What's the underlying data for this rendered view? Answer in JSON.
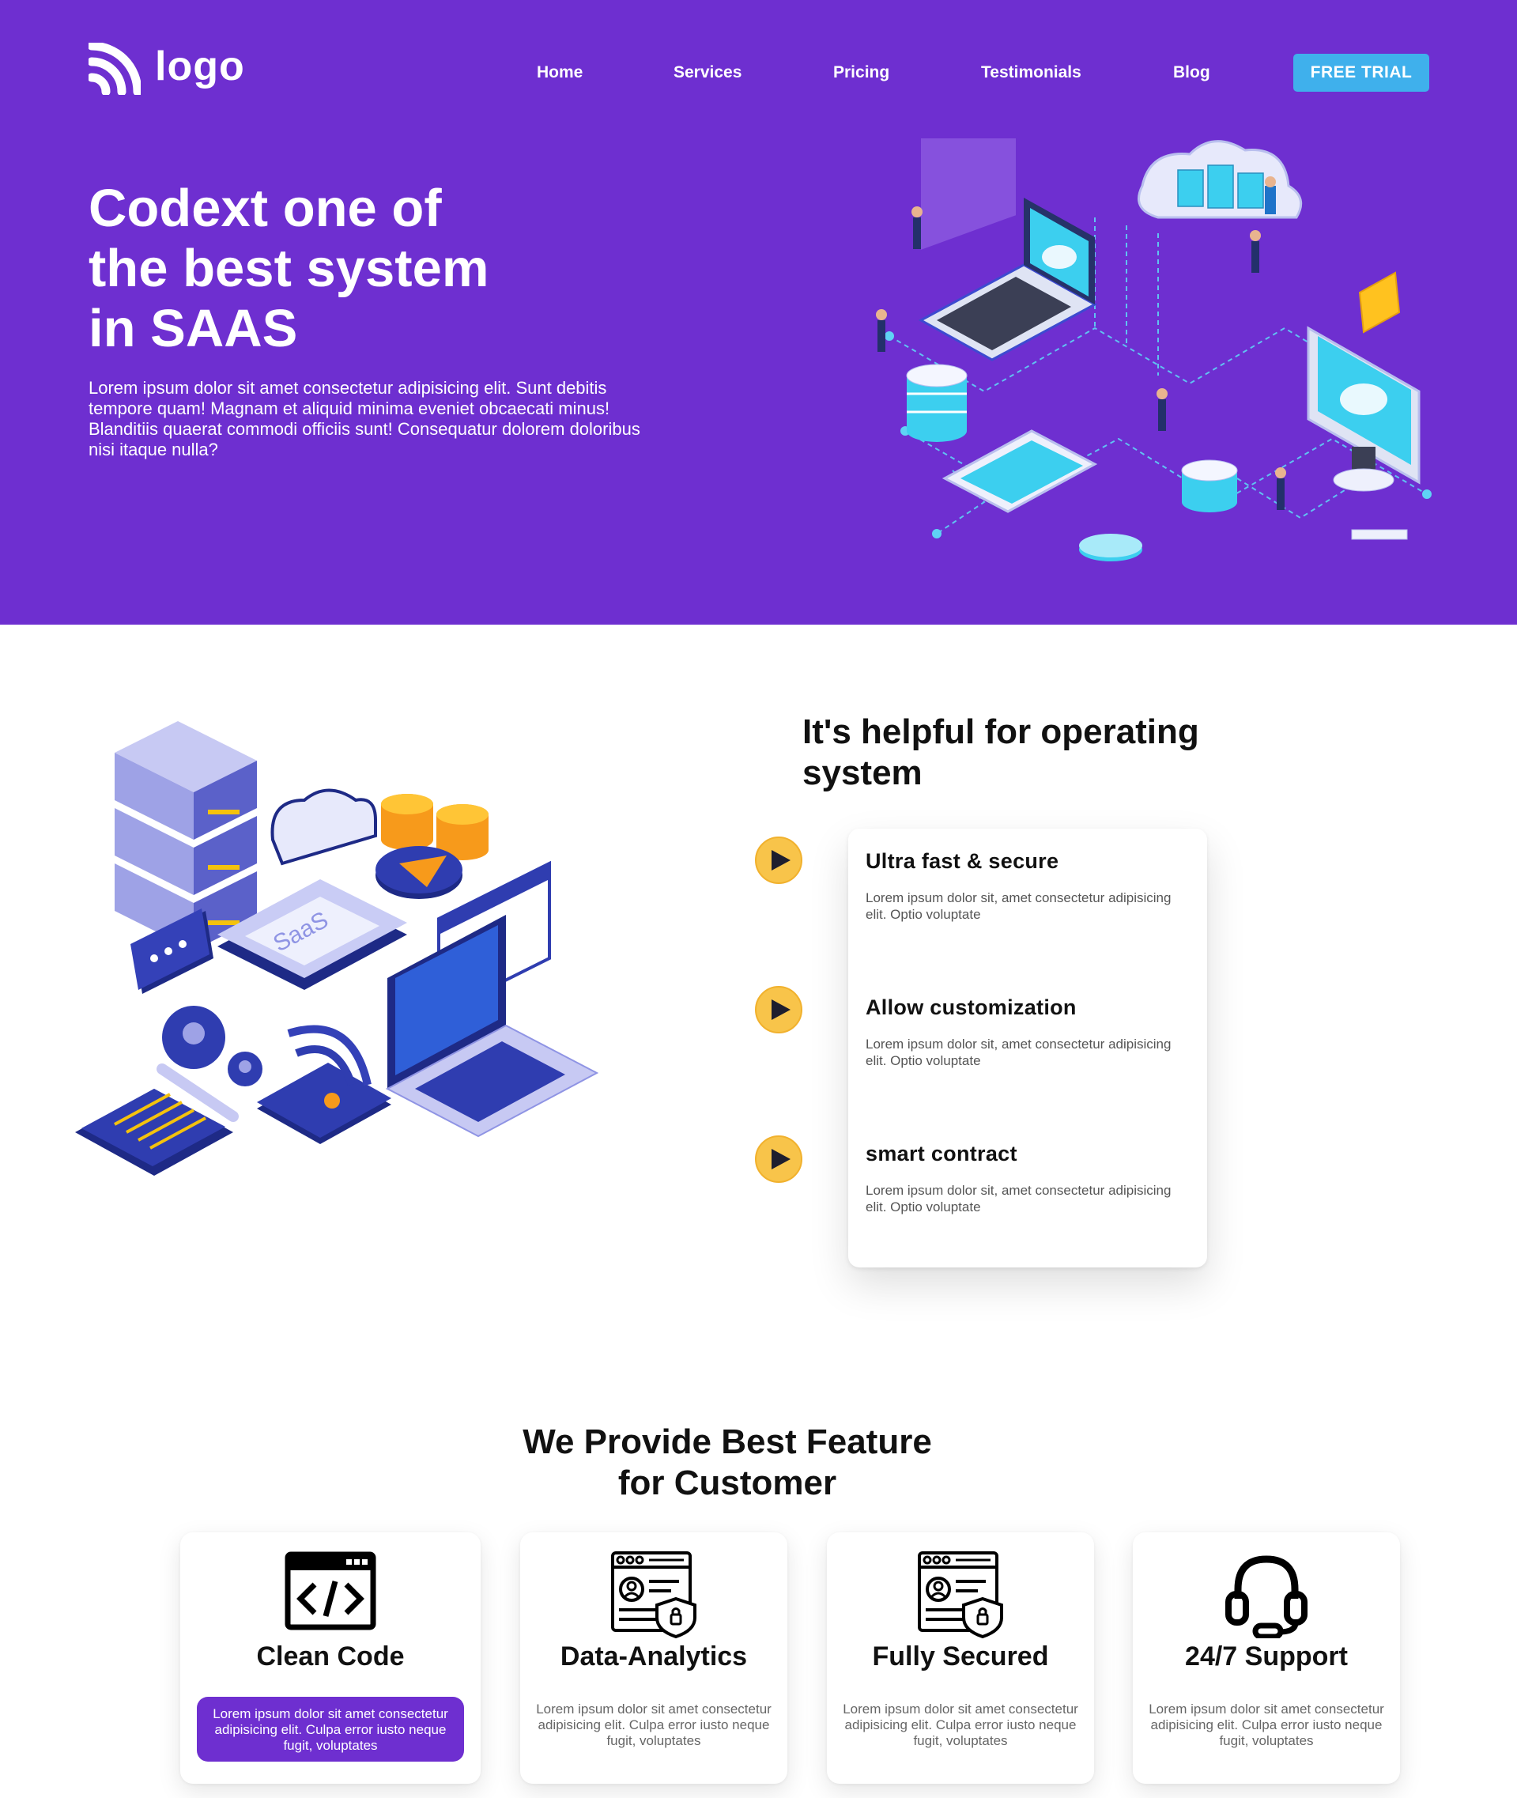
{
  "header": {
    "logo_text": "logo",
    "nav": [
      "Home",
      "Services",
      "Pricing",
      "Testimonials",
      "Blog"
    ],
    "cta_label": "FREE TRIAL"
  },
  "hero": {
    "title_lines": [
      "Codext one of",
      "the best system",
      "in SAAS"
    ],
    "description": "Lorem ipsum dolor sit amet consectetur adipisicing elit. Sunt debitis tempore quam! Magnam et aliquid minima eveniet obcaecati minus! Blanditiis quaerat commodi officiis sunt! Consequatur dolorem doloribus nisi itaque nulla?"
  },
  "helpful": {
    "title": "It's helpful for operating system",
    "items": [
      {
        "title": "Ultra fast & secure",
        "text": "Lorem ipsum dolor sit, amet consectetur adipisicing elit. Optio voluptate"
      },
      {
        "title": "Allow customization",
        "text": "Lorem ipsum dolor sit, amet consectetur adipisicing elit. Optio voluptate"
      },
      {
        "title": "smart contract",
        "text": "Lorem ipsum dolor sit, amet consectetur adipisicing elit. Optio voluptate"
      }
    ]
  },
  "features": {
    "title_lines": [
      "We Provide Best Feature",
      "for Customer"
    ],
    "cards": [
      {
        "title": "Clean Code",
        "icon": "code-window-icon",
        "text": "Lorem ipsum dolor sit amet consectetur adipisicing elit. Culpa error iusto neque fugit, voluptates",
        "highlighted": true
      },
      {
        "title": "Data-Analytics",
        "icon": "secure-profile-icon",
        "text": "Lorem ipsum dolor sit amet consectetur adipisicing elit. Culpa error iusto neque fugit, voluptates",
        "highlighted": false
      },
      {
        "title": "Fully Secured",
        "icon": "secure-profile-icon",
        "text": "Lorem ipsum dolor sit amet consectetur adipisicing elit. Culpa error iusto neque fugit, voluptates",
        "highlighted": false
      },
      {
        "title": "24/7 Support",
        "icon": "headset-icon",
        "text": "Lorem ipsum dolor sit amet consectetur adipisicing elit. Culpa error iusto neque fugit, voluptates",
        "highlighted": false
      }
    ]
  },
  "colors": {
    "brand_purple": "#6e2fd0",
    "cta_blue": "#3fb0ec",
    "play_yellow": "#f8c44a"
  }
}
